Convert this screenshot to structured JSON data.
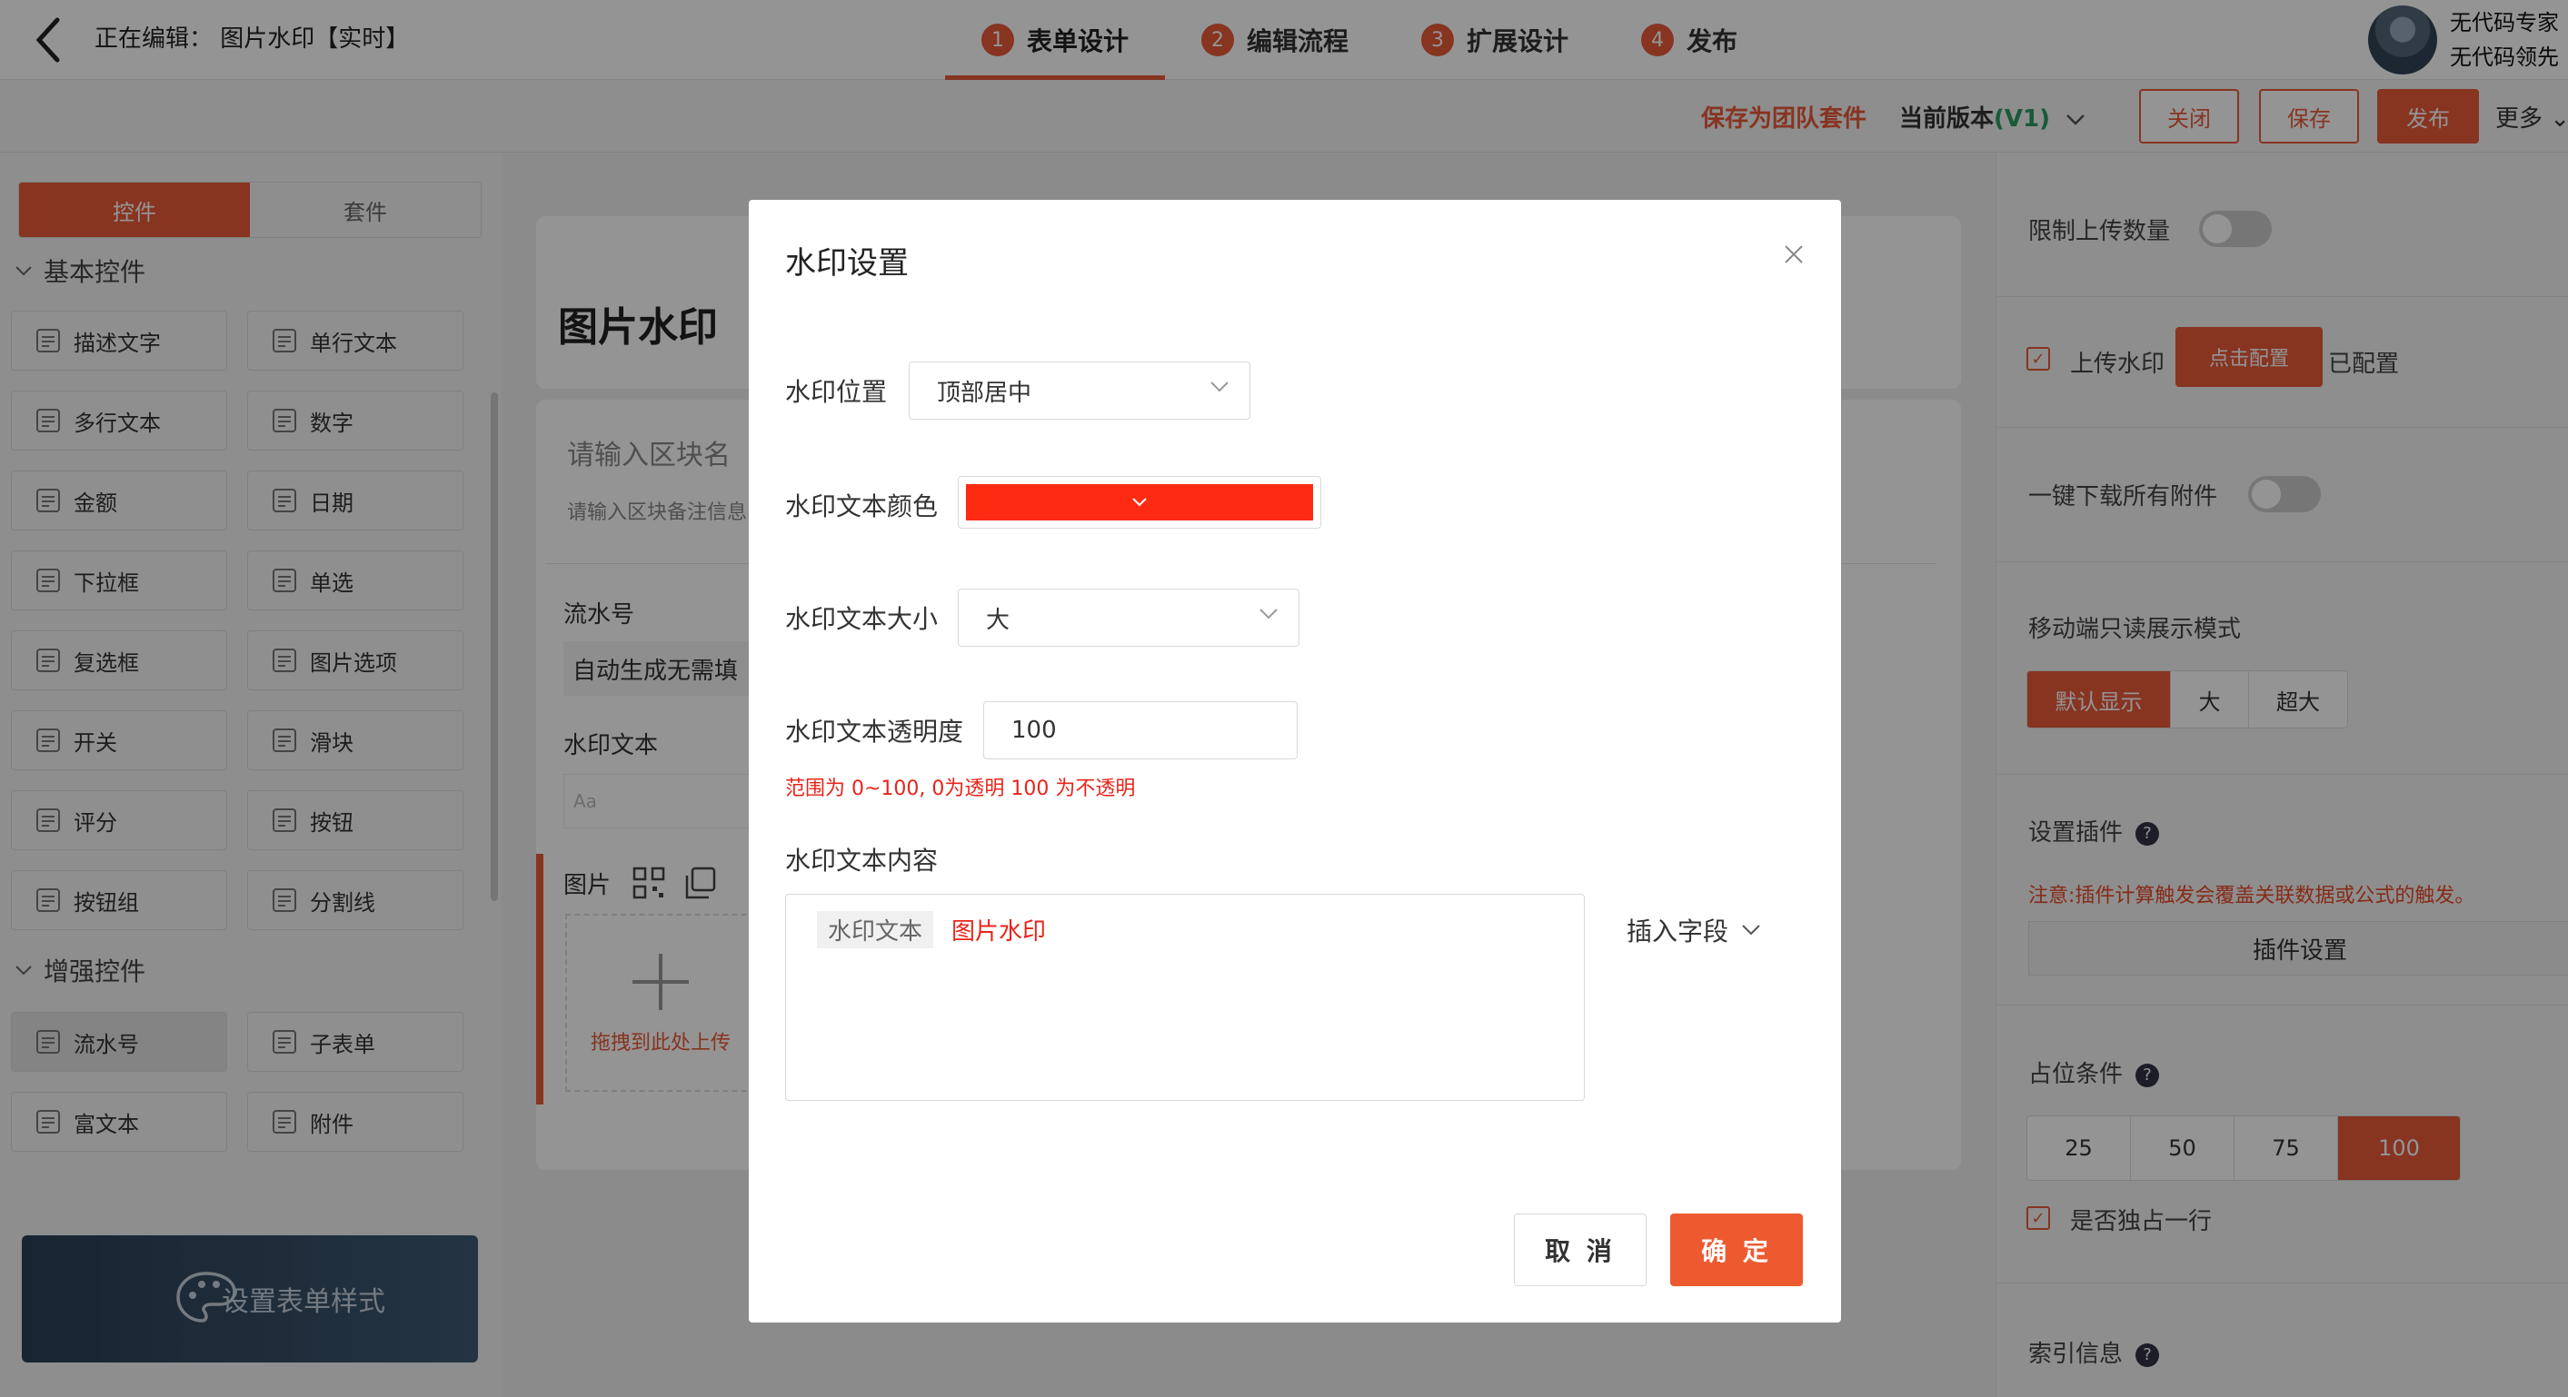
{
  "topbar": {
    "editing_title": "正在编辑： 图片水印【实时】",
    "steps": [
      {
        "num": "1",
        "label": "表单设计"
      },
      {
        "num": "2",
        "label": "编辑流程"
      },
      {
        "num": "3",
        "label": "扩展设计"
      },
      {
        "num": "4",
        "label": "发布"
      }
    ],
    "user_line1": "无代码专家",
    "user_line2": "无代码领先"
  },
  "subbar": {
    "save_suite": "保存为团队套件",
    "version_prefix": "当前版本",
    "version_value": "(V1)",
    "close": "关闭",
    "save": "保存",
    "publish": "发布",
    "more": "更多"
  },
  "left": {
    "tabs": [
      "控件",
      "套件"
    ],
    "basic_title": "基本控件",
    "enhanced_title": "增强控件",
    "basic": [
      {
        "label": "描述文字",
        "icon": "description-icon"
      },
      {
        "label": "单行文本",
        "icon": "text-aa-icon"
      },
      {
        "label": "多行文本",
        "icon": "multiline-icon"
      },
      {
        "label": "数字",
        "icon": "number-icon"
      },
      {
        "label": "金额",
        "icon": "yen-icon"
      },
      {
        "label": "日期",
        "icon": "clock-icon"
      },
      {
        "label": "下拉框",
        "icon": "dropdown-icon"
      },
      {
        "label": "单选",
        "icon": "radio-icon"
      },
      {
        "label": "复选框",
        "icon": "checkbox-icon"
      },
      {
        "label": "图片选项",
        "icon": "image-option-icon"
      },
      {
        "label": "开关",
        "icon": "switch-icon"
      },
      {
        "label": "滑块",
        "icon": "slider-icon"
      },
      {
        "label": "评分",
        "icon": "star-icon"
      },
      {
        "label": "按钮",
        "icon": "button-icon"
      },
      {
        "label": "按钮组",
        "icon": "button-group-icon"
      },
      {
        "label": "分割线",
        "icon": "divider-icon"
      }
    ],
    "enhanced": [
      {
        "label": "流水号",
        "icon": "serial-icon"
      },
      {
        "label": "子表单",
        "icon": "subform-icon"
      },
      {
        "label": "富文本",
        "icon": "richtext-icon"
      },
      {
        "label": "附件",
        "icon": "attachment-icon"
      }
    ],
    "style_banner": "设置表单样式"
  },
  "canvas": {
    "form_title": "图片水印",
    "block_name_placeholder": "请输入区块名",
    "block_note_placeholder": "请输入区块备注信息",
    "serial_label": "流水号",
    "serial_value": "自动生成无需填",
    "watermark_text_label": "水印文本",
    "watermark_text_input": "Aa",
    "image_label": "图片",
    "upload_hint": "拖拽到此处上传"
  },
  "right": {
    "limit_upload": "限制上传数量",
    "upload_watermark": "上传水印",
    "click_config": "点击配置",
    "configured": "已配置",
    "download_all": "一键下载所有附件",
    "mobile_mode": "移动端只读展示模式",
    "mobile_options": [
      "默认显示",
      "大",
      "超大"
    ],
    "plugin_title": "设置插件",
    "plugin_warning": "注意:插件计算触发会覆盖关联数据或公式的触发。",
    "plugin_button": "插件设置",
    "width_title": "占位条件",
    "width_options": [
      "25",
      "50",
      "75",
      "100"
    ],
    "full_row": "是否独占一行",
    "index_info": "索引信息",
    "help_glyph": "?"
  },
  "modal": {
    "title": "水印设置",
    "position_label": "水印位置",
    "position_value": "顶部居中",
    "color_label": "水印文本颜色",
    "color_value": "#ff2a12",
    "size_label": "水印文本大小",
    "size_value": "大",
    "opacity_label": "水印文本透明度",
    "opacity_value": "100",
    "opacity_hint": "范围为 0~100, 0为透明 100 为不透明",
    "content_label": "水印文本内容",
    "content_field_tag": "水印文本",
    "content_text": "图片水印",
    "insert_field": "插入字段",
    "cancel": "取 消",
    "ok": "确 定"
  },
  "colors": {
    "accent": "#e85a3a",
    "version_green": "#2e9c62",
    "hint_red": "#e8241a"
  }
}
